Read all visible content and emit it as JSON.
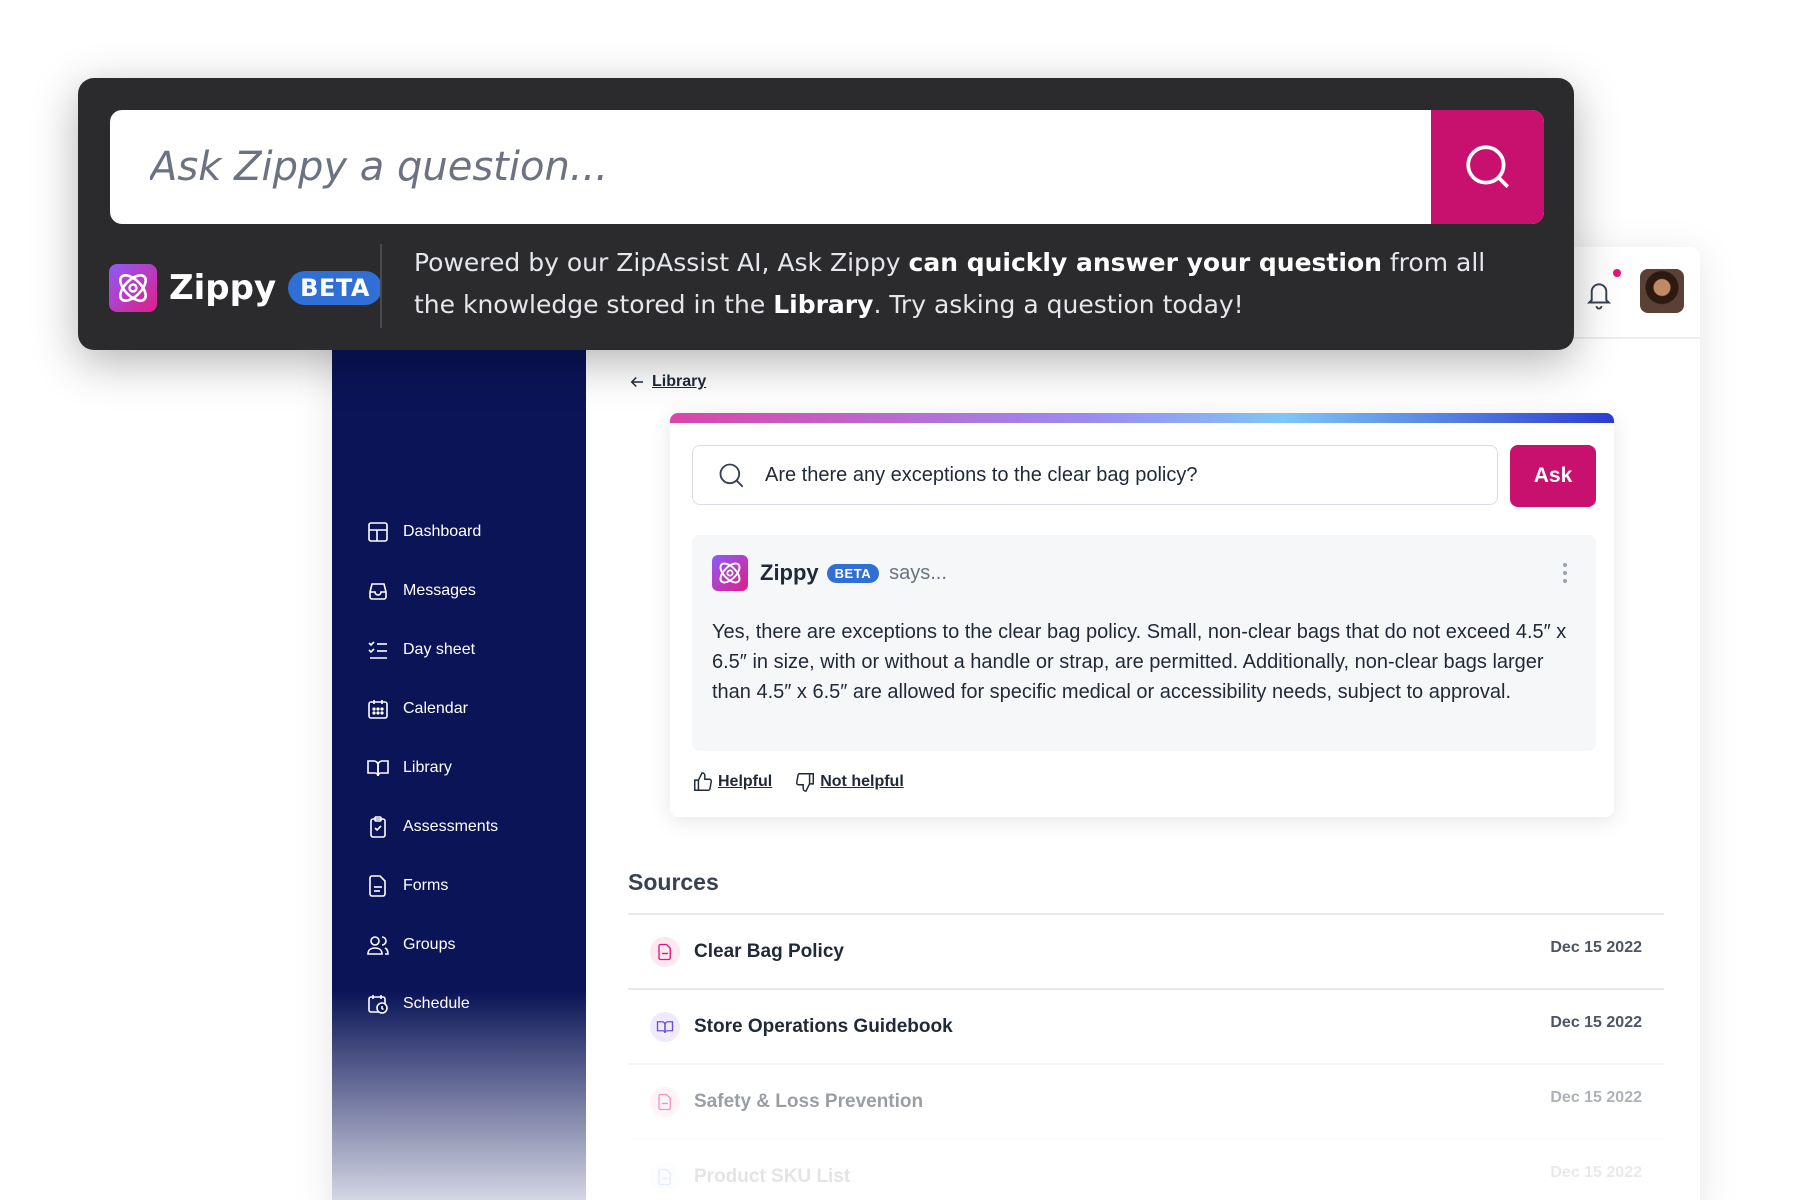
{
  "panel": {
    "search_placeholder": "Ask Zippy a question...",
    "brand": "Zippy",
    "beta": "BETA",
    "blurb": {
      "p1": "Powered by our ZipAssist AI, Ask Zippy ",
      "b1": "can quickly answer your question",
      "p2": " from all the knowledge stored in the ",
      "b2": "Library",
      "p3": ". Try asking a question today!"
    }
  },
  "sidebar": {
    "items": [
      {
        "label": "Dashboard",
        "icon": "dashboard-icon"
      },
      {
        "label": "Messages",
        "icon": "inbox-icon"
      },
      {
        "label": "Day sheet",
        "icon": "checklist-icon"
      },
      {
        "label": "Calendar",
        "icon": "calendar-icon"
      },
      {
        "label": "Library",
        "icon": "book-icon"
      },
      {
        "label": "Assessments",
        "icon": "clipboard-check-icon"
      },
      {
        "label": "Forms",
        "icon": "document-icon"
      },
      {
        "label": "Groups",
        "icon": "users-icon"
      },
      {
        "label": "Schedule",
        "icon": "calendar-clock-icon"
      }
    ]
  },
  "main": {
    "breadcrumb": "Library",
    "question": "Are there any exceptions to the clear bag policy?",
    "ask_label": "Ask",
    "response": {
      "name": "Zippy",
      "beta": "BETA",
      "says": "says...",
      "text": "Yes, there are exceptions to the clear bag policy. Small, non-clear bags that do not exceed 4.5″ x 6.5″ in size, with or without a handle or strap, are permitted. Additionally, non-clear bags larger than 4.5″ x 6.5″ are allowed for specific medical or accessibility needs, subject to approval."
    },
    "feedback": {
      "helpful": "Helpful",
      "not_helpful": "Not helpful"
    },
    "sources_title": "Sources",
    "sources": [
      {
        "name": "Clear Bag Policy",
        "date": "Dec 15 2022",
        "icon": "pdf-icon",
        "color": "#e0167a"
      },
      {
        "name": "Store Operations Guidebook",
        "date": "Dec 15 2022",
        "icon": "book-icon",
        "color": "#6d4ed8"
      },
      {
        "name": "Safety & Loss Prevention",
        "date": "Dec 15 2022",
        "icon": "pdf-icon",
        "color": "#e0167a"
      },
      {
        "name": "Product SKU List",
        "date": "Dec 15 2022",
        "icon": "document-icon",
        "color": "#2f6fd6"
      }
    ]
  },
  "colors": {
    "accent": "#c8106e",
    "sidebar": "#0b1457",
    "beta": "#2f6fd6",
    "panel": "#2b2b2d"
  }
}
